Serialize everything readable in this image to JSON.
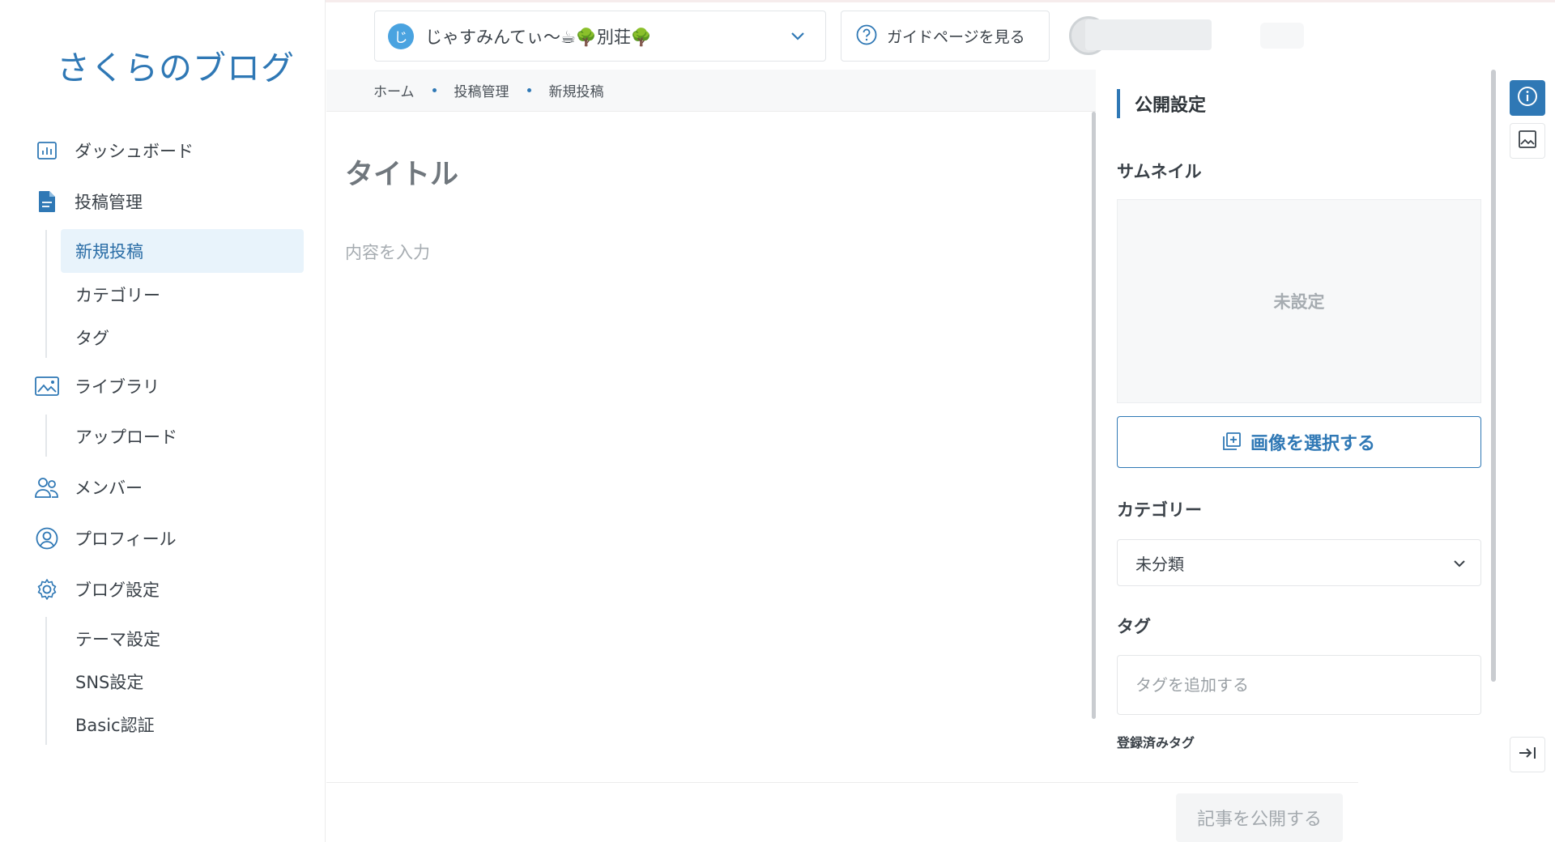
{
  "app": {
    "logo": "さくらのブログ"
  },
  "sidebar": {
    "items": [
      {
        "label": "ダッシュボード",
        "icon": "chart-icon"
      },
      {
        "label": "投稿管理",
        "icon": "document-icon"
      },
      {
        "label": "ライブラリ",
        "icon": "image-icon"
      },
      {
        "label": "メンバー",
        "icon": "users-icon"
      },
      {
        "label": "プロフィール",
        "icon": "user-circle-icon"
      },
      {
        "label": "ブログ設定",
        "icon": "gear-icon"
      }
    ],
    "posts_sub": [
      "新規投稿",
      "カテゴリー",
      "タグ"
    ],
    "library_sub": [
      "アップロード"
    ],
    "settings_sub": [
      "テーマ設定",
      "SNS設定",
      "Basic認証"
    ]
  },
  "header": {
    "blog_avatar_letter": "じ",
    "blog_name": "じゃすみんてぃ〜☕🌳別荘🌳",
    "guide_label": "ガイドページを見る"
  },
  "breadcrumb": [
    "ホーム",
    "投稿管理",
    "新規投稿"
  ],
  "editor": {
    "title_placeholder": "タイトル",
    "content_placeholder": "内容を入力"
  },
  "panel": {
    "title": "公開設定",
    "thumbnail_label": "サムネイル",
    "thumbnail_value": "未設定",
    "select_image_label": "画像を選択する",
    "category_label": "カテゴリー",
    "category_value": "未分類",
    "tag_label": "タグ",
    "tag_placeholder": "タグを追加する",
    "registered_tags_label": "登録済みタグ"
  },
  "footer": {
    "publish_label": "記事を公開する"
  },
  "colors": {
    "accent": "#2f78b5",
    "active_bg": "#e8f3fb"
  }
}
